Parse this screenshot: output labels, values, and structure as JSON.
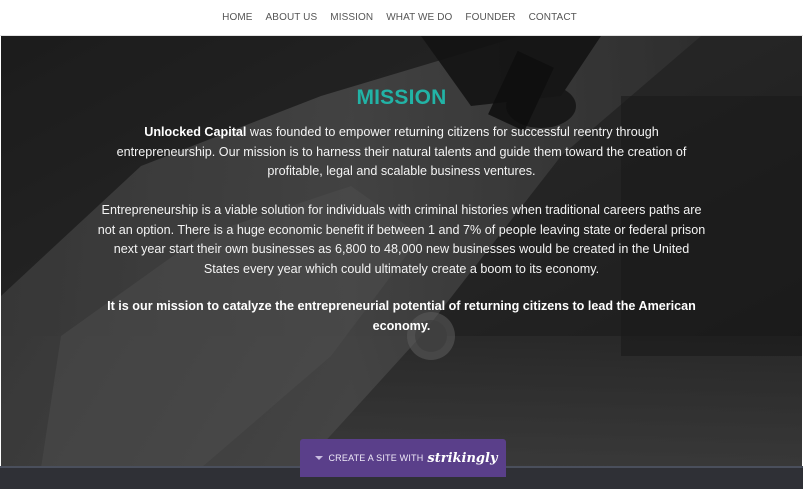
{
  "nav": {
    "items": [
      "HOME",
      "ABOUT US",
      "MISSION",
      "WHAT WE DO",
      "FOUNDER",
      "CONTACT"
    ]
  },
  "mission": {
    "title": "MISSION",
    "para1_strong": "Unlocked Capital",
    "para1_rest": " was founded to empower returning citizens for successful reentry through entrepreneurship. Our mission is to harness their natural talents and guide them toward the creation of profitable, legal and scalable business ventures.",
    "para2": "Entrepreneurship is a viable solution for individuals with criminal histories when traditional careers paths are not an option. There is a huge economic benefit if between 1 and 7% of people leaving state or federal prison next year start their own businesses as 6,800 to 48,000 new businesses would be created in the United States every year which could ultimately create a boom to its economy.",
    "para3": "It is our mission to catalyze the entrepreneurial potential of returning citizens to lead the American economy."
  },
  "badge": {
    "text": "CREATE A SITE WITH",
    "brand": "strikingly",
    "icon": "caret-down-icon"
  },
  "colors": {
    "accent": "#22b3a6",
    "badge_bg": "#5a3f8a",
    "nav_text": "#555555"
  }
}
